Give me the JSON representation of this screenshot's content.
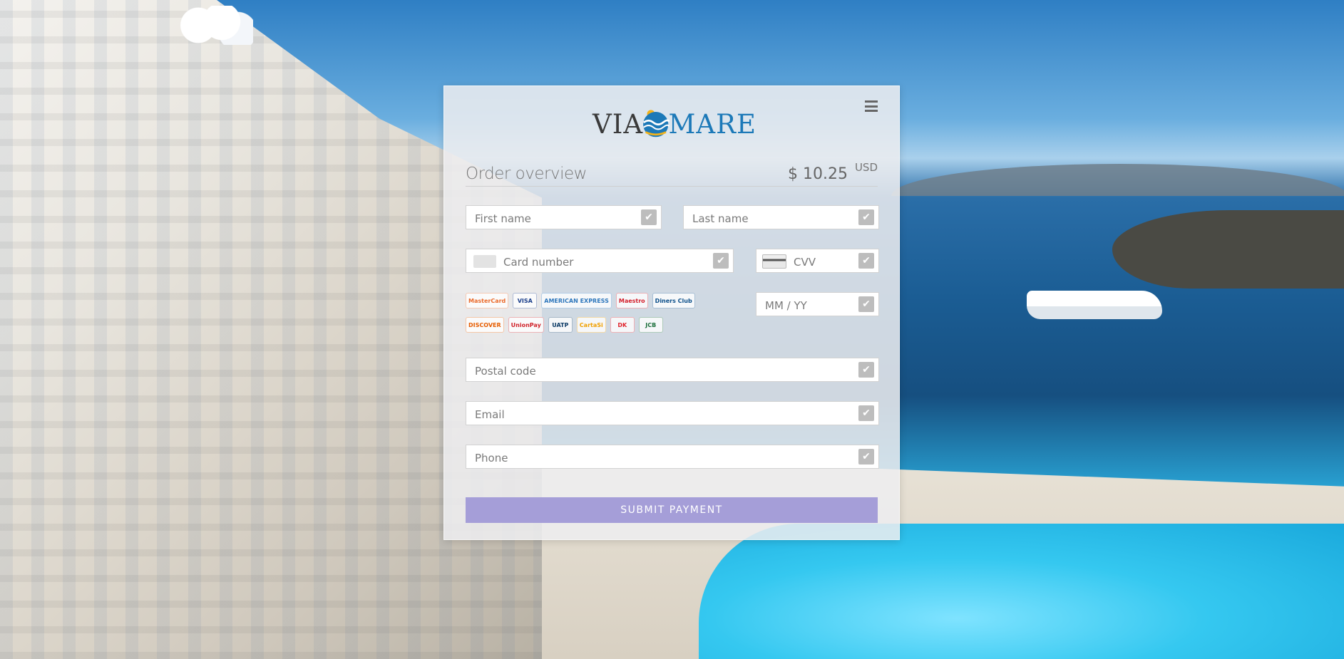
{
  "brand": {
    "left": "VIA",
    "right": "MARE"
  },
  "order": {
    "title": "Order overview",
    "amount": "$ 10.25",
    "currency": "USD"
  },
  "form": {
    "first_name": "First name",
    "last_name": "Last name",
    "card_number": "Card number",
    "cvv": "CVV",
    "expiry": "MM / YY",
    "postal_code": "Postal code",
    "email": "Email",
    "phone": "Phone",
    "check_glyph": "✔"
  },
  "card_brands": [
    {
      "name": "mastercard",
      "label": "MasterCard",
      "color": "#eb6a2a"
    },
    {
      "name": "visa",
      "label": "VISA",
      "color": "#1a3e8a"
    },
    {
      "name": "amex",
      "label": "AMERICAN EXPRESS",
      "color": "#2e77bc"
    },
    {
      "name": "maestro",
      "label": "Maestro",
      "color": "#d4202c"
    },
    {
      "name": "diners",
      "label": "Diners Club",
      "color": "#0b4f8a"
    },
    {
      "name": "discover",
      "label": "DISCOVER",
      "color": "#e65c00"
    },
    {
      "name": "unionpay",
      "label": "UnionPay",
      "color": "#d0232a"
    },
    {
      "name": "uatp",
      "label": "UATP",
      "color": "#0d3b66"
    },
    {
      "name": "cartasi",
      "label": "CartaSi",
      "color": "#f0a000"
    },
    {
      "name": "dankort",
      "label": "DK",
      "color": "#e0242c"
    },
    {
      "name": "jcb",
      "label": "JCB",
      "color": "#1a6e3a"
    }
  ],
  "actions": {
    "submit": "SUBMIT PAYMENT"
  },
  "colors": {
    "submit_bg": "#a59ed8",
    "logo_blue": "#1c79b8",
    "logo_sun": "#f2b21a"
  }
}
